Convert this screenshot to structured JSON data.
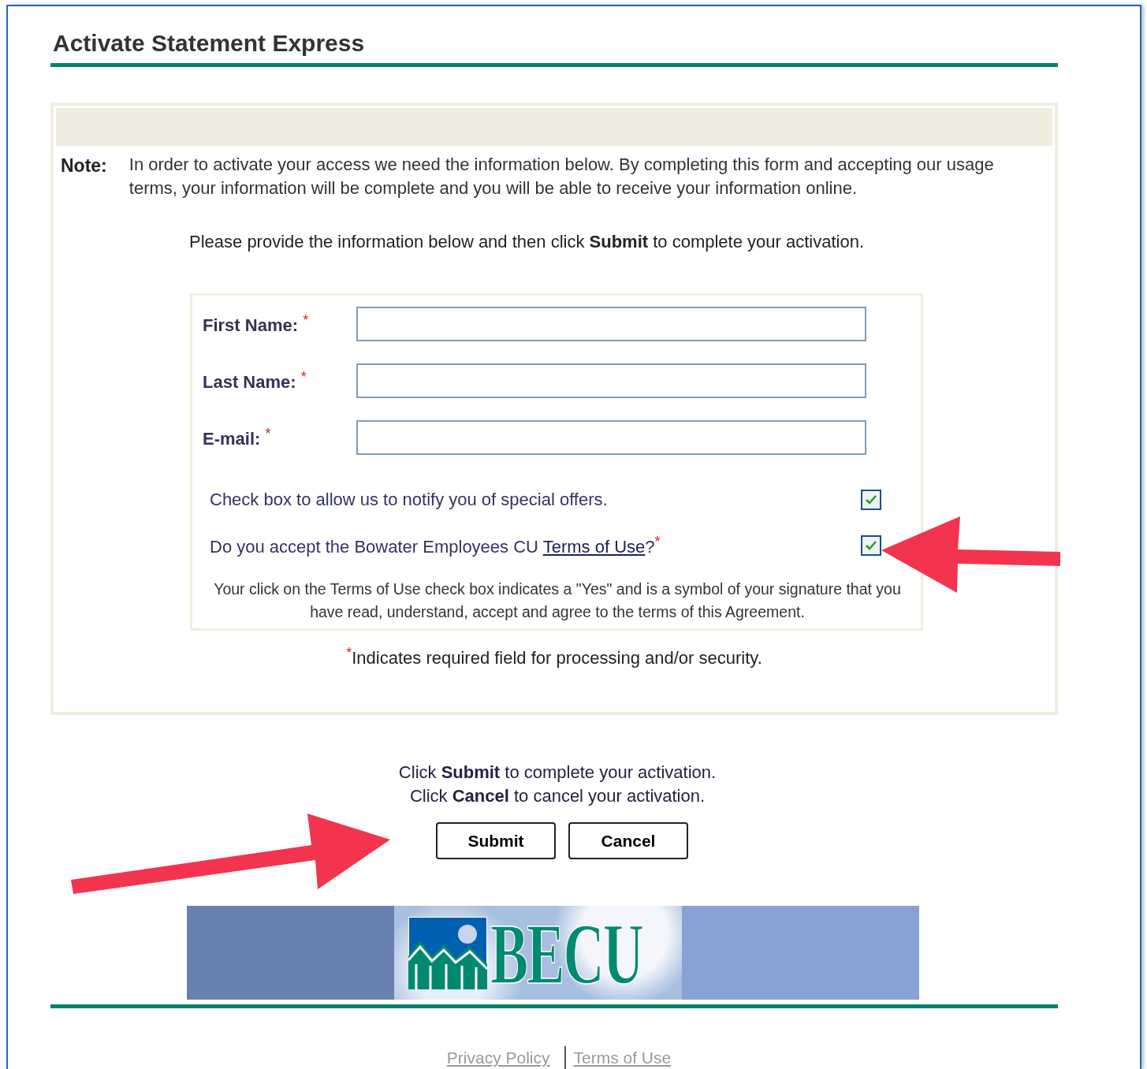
{
  "title": "Activate Statement Express",
  "note": {
    "label": "Note:",
    "text": "In order to activate your access we need the information below. By completing this form and accepting our usage terms, your information will be complete and you will be able to receive your information online."
  },
  "instruction": "Please provide the information below and then click **Submit** to complete your activation.",
  "fields": [
    {
      "label": "First Name:",
      "required_mark": "*"
    },
    {
      "label": "Last Name:",
      "required_mark": "*"
    },
    {
      "label": "E-mail:",
      "required_mark": "*"
    }
  ],
  "checkboxes": [
    {
      "label": "Check box to allow us to notify you of special offers.",
      "checked": true
    },
    {
      "label": "Do you accept the Bowater Employees CU ",
      "link": "Terms of Use",
      "suffix": "?",
      "required_mark": "*",
      "checked": true
    }
  ],
  "terms_note": "Your click on the Terms of Use check box indicates a \"Yes\" and is a symbol of your signature that you have read, understand, accept and agree to the terms of this Agreement.",
  "required_note": {
    "mark": "*",
    "text": "Indicates required field for processing and/or security."
  },
  "actions_text": [
    "Click **Submit** to complete your activation.",
    "Click **Cancel** to cancel your activation."
  ],
  "buttons": [
    "Submit",
    "Cancel"
  ],
  "logo": {
    "text": "BECU"
  },
  "footer_links": [
    "Privacy Policy",
    "Terms of Use"
  ]
}
